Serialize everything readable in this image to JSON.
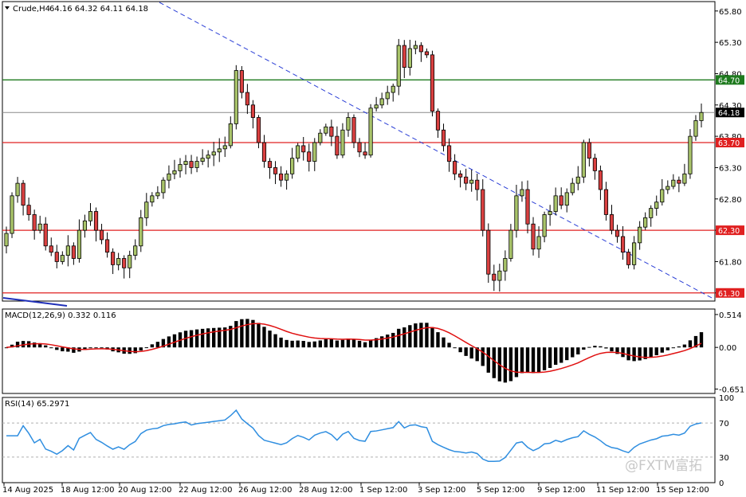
{
  "chart_data": {
    "type": "candlestick",
    "symbol_line": "Crude,H4",
    "ohlc_line": "64.16 64.32 64.11 64.18",
    "price_axis": {
      "min": 61.17,
      "max": 65.95,
      "ticks": [
        "65.80",
        "65.30",
        "64.80",
        "64.30",
        "63.80",
        "63.30",
        "62.80",
        "62.30",
        "61.80",
        "61.30"
      ]
    },
    "current_price": {
      "value": 64.18,
      "label": "64.18"
    },
    "levels": [
      {
        "value": 64.7,
        "label": "64.70",
        "color": "#1e7a1e"
      },
      {
        "value": 63.7,
        "label": "63.70",
        "color": "#e02020"
      },
      {
        "value": 62.3,
        "label": "62.30",
        "color": "#e02020"
      },
      {
        "value": 61.3,
        "label": "61.30",
        "color": "#e02020"
      }
    ],
    "time_labels": [
      "14 Aug 2025",
      "18 Aug 12:00",
      "20 Aug 12:00",
      "22 Aug 12:00",
      "26 Aug 12:00",
      "28 Aug 12:00",
      "1 Sep 12:00",
      "3 Sep 12:00",
      "5 Sep 12:00",
      "9 Sep 12:00",
      "11 Sep 12:00",
      "15 Sep 12:00"
    ],
    "closes": [
      62.25,
      62.85,
      63.05,
      62.7,
      62.55,
      62.3,
      62.4,
      62.05,
      61.95,
      61.8,
      61.9,
      62.05,
      61.85,
      62.3,
      62.45,
      62.6,
      62.3,
      62.15,
      61.95,
      61.75,
      61.85,
      61.7,
      61.9,
      62.05,
      62.5,
      62.75,
      62.85,
      62.9,
      63.1,
      63.2,
      63.25,
      63.35,
      63.4,
      63.3,
      63.4,
      63.45,
      63.5,
      63.55,
      63.6,
      63.65,
      64.0,
      64.85,
      64.5,
      64.3,
      64.1,
      63.7,
      63.4,
      63.3,
      63.2,
      63.1,
      63.2,
      63.45,
      63.65,
      63.55,
      63.4,
      63.7,
      63.85,
      63.95,
      63.8,
      63.5,
      63.9,
      64.1,
      63.7,
      63.55,
      63.5,
      64.25,
      64.3,
      64.4,
      64.5,
      64.6,
      65.25,
      64.9,
      65.2,
      65.25,
      65.15,
      65.1,
      64.2,
      63.9,
      63.65,
      63.4,
      63.2,
      63.15,
      63.05,
      63.1,
      62.95,
      62.3,
      61.6,
      61.5,
      61.65,
      61.85,
      62.3,
      62.85,
      62.95,
      62.4,
      62.0,
      62.2,
      62.55,
      62.6,
      62.85,
      62.7,
      62.9,
      63.05,
      63.15,
      63.7,
      63.45,
      63.25,
      62.95,
      62.55,
      62.3,
      62.2,
      61.95,
      61.75,
      62.1,
      62.35,
      62.5,
      62.65,
      62.75,
      62.95,
      63.0,
      63.1,
      63.05,
      63.2,
      63.8,
      64.05,
      64.18
    ],
    "macd": {
      "label": "MACD(12,26,9) 0.332 0.116",
      "ticks": [
        "0.514",
        "0.00",
        "-0.651"
      ],
      "min": -0.72,
      "max": 0.6
    },
    "rsi": {
      "label": "RSI(14) 65.2971",
      "ticks": [
        "100",
        "70",
        "30",
        "0"
      ]
    },
    "watermark": "@FXTM富拓"
  }
}
